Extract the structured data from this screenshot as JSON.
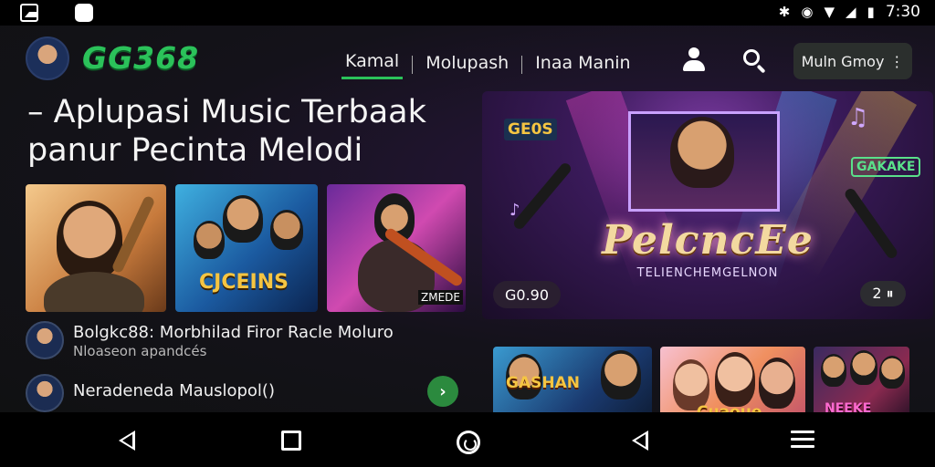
{
  "status_bar": {
    "left_icons": [
      "gallery-icon",
      "app-icon"
    ],
    "right_icons": [
      "bluetooth-icon",
      "alarm-icon",
      "wifi-icon",
      "signal-icon",
      "battery-icon"
    ],
    "time": "7:30"
  },
  "header": {
    "brand": "GG368",
    "tabs": [
      {
        "label": "Kamal",
        "active": true
      },
      {
        "label": "Molupash",
        "active": false
      },
      {
        "label": "Inaa Manin",
        "active": false
      }
    ],
    "menu_button_label": "Muln Gmoy",
    "menu_button_glyph": "⋮"
  },
  "headline": "– Aplupasi Music Terbaak panur Pecinta Melodi",
  "thumbnails": [
    {
      "label": ""
    },
    {
      "label": "CJCEINS"
    },
    {
      "label": "ZMEDE"
    }
  ],
  "list": [
    {
      "title": "Bolgkc88: Morbhilad Firor Racle Moluro",
      "subtitle": "Nloaseon apandcés"
    },
    {
      "title": "Neradeneda Mauslopol()",
      "subtitle": "",
      "action_glyph": "›"
    }
  ],
  "banner": {
    "title": "PelcncEe",
    "subtitle": "TELIENCHEMGELNON",
    "logo_left": "GE0S",
    "logo_right": "GAKAKE",
    "pill_left": "G0.90",
    "pill_right": "2 ⏸"
  },
  "cards": [
    {
      "label": "GASHAN"
    },
    {
      "label": "Cuaoue"
    },
    {
      "label": "NEEKE"
    }
  ],
  "colors": {
    "accent": "#2bc25a",
    "background": "#111213",
    "play_button": "#2b8a3e"
  }
}
